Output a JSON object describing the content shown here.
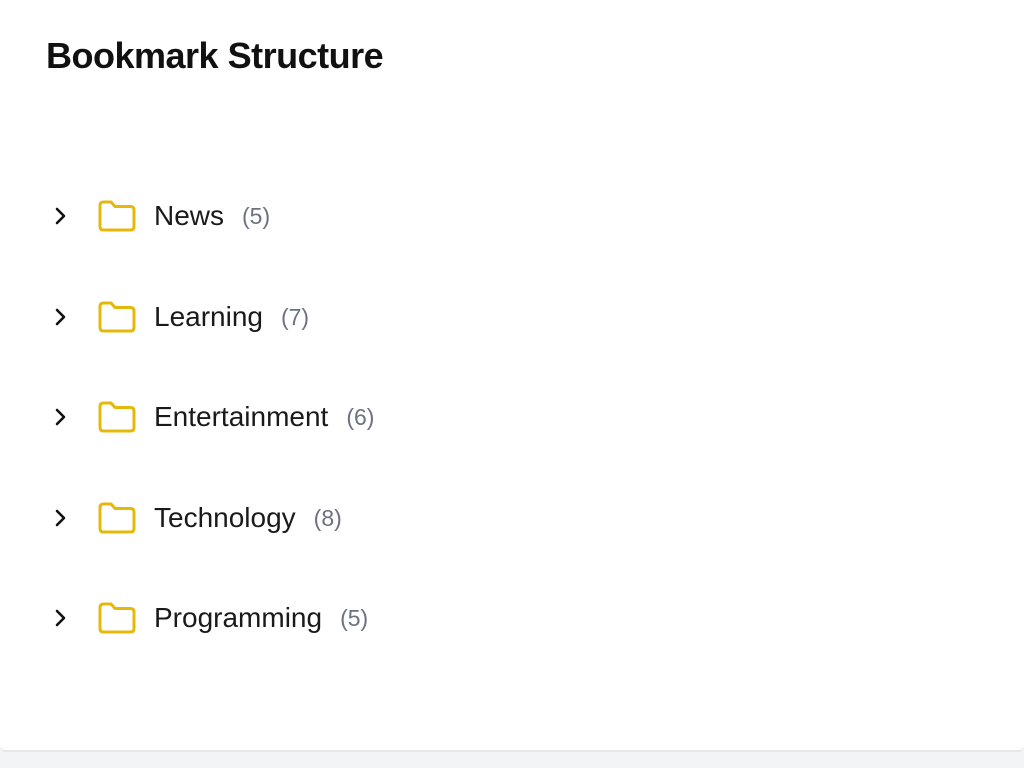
{
  "page": {
    "title": "Bookmark Structure"
  },
  "colors": {
    "folder": "#e5b80b",
    "chevron": "#111111",
    "count": "#6b7280"
  },
  "icons": {
    "expand": "chevron-right-icon",
    "folder": "folder-icon"
  },
  "folders": [
    {
      "name": "News",
      "count": "(5)"
    },
    {
      "name": "Learning",
      "count": "(7)"
    },
    {
      "name": "Entertainment",
      "count": "(6)"
    },
    {
      "name": "Technology",
      "count": "(8)"
    },
    {
      "name": "Programming",
      "count": "(5)"
    }
  ]
}
